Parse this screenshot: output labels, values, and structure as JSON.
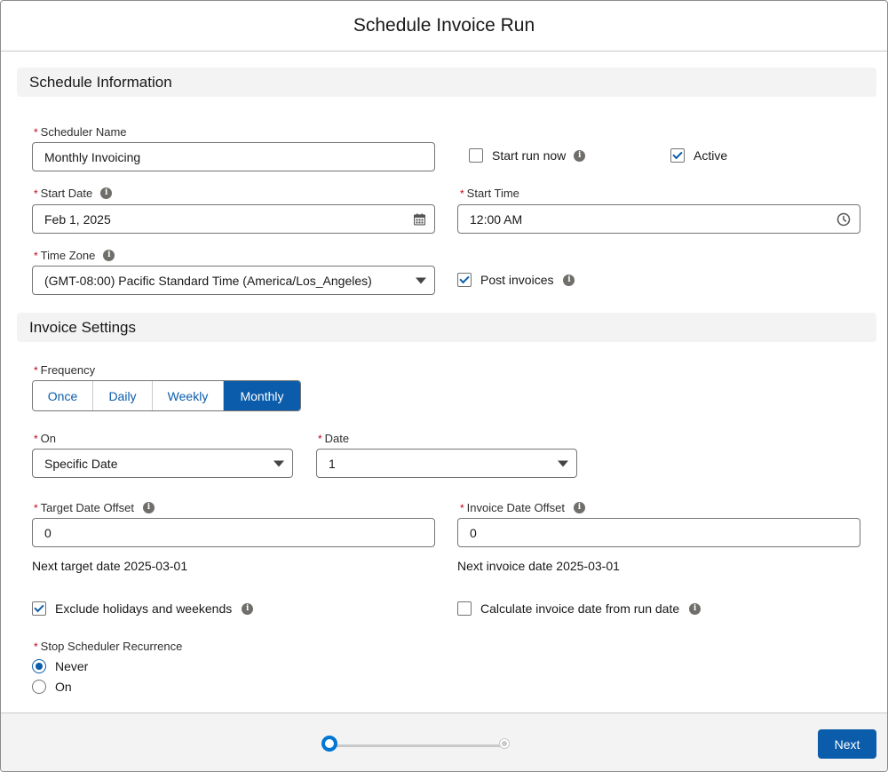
{
  "modal": {
    "title": "Schedule Invoice Run"
  },
  "schedule_section": {
    "heading": "Schedule Information",
    "required_marker": "*",
    "scheduler_name": {
      "label": "Scheduler Name",
      "value": "Monthly Invoicing"
    },
    "start_run_now": {
      "label": "Start run now",
      "checked": false
    },
    "active": {
      "label": "Active",
      "checked": true
    },
    "start_date": {
      "label": "Start Date",
      "value": "Feb 1, 2025"
    },
    "start_time": {
      "label": "Start Time",
      "value": "12:00 AM"
    },
    "time_zone": {
      "label": "Time Zone",
      "value": "(GMT-08:00) Pacific Standard Time (America/Los_Angeles)"
    },
    "post_invoices": {
      "label": "Post invoices",
      "checked": true
    }
  },
  "invoice_section": {
    "heading": "Invoice Settings",
    "frequency": {
      "label": "Frequency",
      "options": [
        "Once",
        "Daily",
        "Weekly",
        "Monthly"
      ],
      "selected": "Monthly"
    },
    "on": {
      "label": "On",
      "value": "Specific Date"
    },
    "date": {
      "label": "Date",
      "value": "1"
    },
    "target_date_offset": {
      "label": "Target Date Offset",
      "value": "0",
      "helper": "Next target date 2025-03-01"
    },
    "invoice_date_offset": {
      "label": "Invoice Date Offset",
      "value": "0",
      "helper": "Next invoice date 2025-03-01"
    },
    "exclude_holidays": {
      "label": "Exclude holidays and weekends",
      "checked": true
    },
    "calc_from_run_date": {
      "label": "Calculate invoice date from run date",
      "checked": false
    },
    "stop_recurrence": {
      "label": "Stop Scheduler Recurrence",
      "options": [
        "Never",
        "On"
      ],
      "selected": "Never"
    }
  },
  "footer": {
    "progress": {
      "current_step": 1,
      "total_steps": 2
    },
    "next_label": "Next"
  },
  "icons": {
    "info": "i"
  },
  "colors": {
    "brand": "#0b5cab",
    "required": "#ba0517",
    "progress_active": "#0176d3"
  }
}
